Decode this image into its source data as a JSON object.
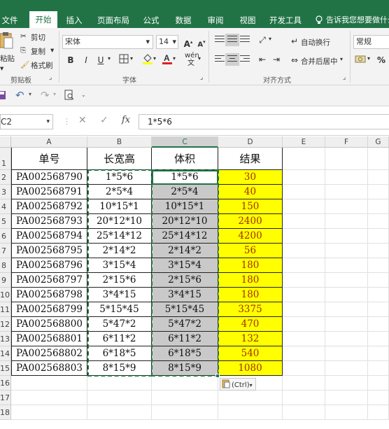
{
  "tabs": {
    "file": "文件",
    "home": "开始",
    "insert": "插入",
    "layout": "页面布局",
    "formulas": "公式",
    "data": "数据",
    "review": "审阅",
    "view": "视图",
    "developer": "开发工具",
    "tell_me": "告诉我您想要做什么"
  },
  "clipboard": {
    "paste": "粘贴",
    "cut": "剪切",
    "copy": "复制",
    "format_painter": "格式刷",
    "group_label": "剪贴板"
  },
  "font": {
    "name": "宋体",
    "size": "14",
    "group_label": "字体",
    "bold": "B",
    "italic": "I",
    "underline": "U"
  },
  "alignment": {
    "wrap_text": "自动换行",
    "merge_center": "合并后居中",
    "group_label": "对齐方式"
  },
  "number": {
    "format": "常规",
    "percent": "%"
  },
  "formula_bar": {
    "name_box": "C2",
    "formula": "1*5*6"
  },
  "columns": [
    "A",
    "B",
    "C",
    "D",
    "E",
    "F",
    "G"
  ],
  "header_row": {
    "a": "单号",
    "b": "长宽高",
    "c": "体积",
    "d": "结果"
  },
  "rows": [
    {
      "n": "2",
      "a": "PA002568790",
      "b": "1*5*6",
      "c": "1*5*6",
      "d": "30"
    },
    {
      "n": "3",
      "a": "PA002568791",
      "b": "2*5*4",
      "c": "2*5*4",
      "d": "40"
    },
    {
      "n": "4",
      "a": "PA002568792",
      "b": "10*15*1",
      "c": "10*15*1",
      "d": "150"
    },
    {
      "n": "5",
      "a": "PA002568793",
      "b": "20*12*10",
      "c": "20*12*10",
      "d": "2400"
    },
    {
      "n": "6",
      "a": "PA002568794",
      "b": "25*14*12",
      "c": "25*14*12",
      "d": "4200"
    },
    {
      "n": "7",
      "a": "PA002568795",
      "b": "2*14*2",
      "c": "2*14*2",
      "d": "56"
    },
    {
      "n": "8",
      "a": "PA002568796",
      "b": "3*15*4",
      "c": "3*15*4",
      "d": "180"
    },
    {
      "n": "9",
      "a": "PA002568797",
      "b": "2*15*6",
      "c": "2*15*6",
      "d": "180"
    },
    {
      "n": "10",
      "a": "PA002568798",
      "b": "3*4*15",
      "c": "3*4*15",
      "d": "180"
    },
    {
      "n": "11",
      "a": "PA002568799",
      "b": "5*15*45",
      "c": "5*15*45",
      "d": "3375"
    },
    {
      "n": "12",
      "a": "PA002568800",
      "b": "5*47*2",
      "c": "5*47*2",
      "d": "470"
    },
    {
      "n": "13",
      "a": "PA002568801",
      "b": "6*11*2",
      "c": "6*11*2",
      "d": "132"
    },
    {
      "n": "14",
      "a": "PA002568802",
      "b": "6*18*5",
      "c": "6*18*5",
      "d": "540"
    },
    {
      "n": "15",
      "a": "PA002568803",
      "b": "8*15*9",
      "c": "8*15*9",
      "d": "1080"
    }
  ],
  "extra_rows": [
    "16",
    "17",
    "18"
  ],
  "header_row_num": "1",
  "paste_options": "(Ctrl)",
  "colors": {
    "accent": "#217346",
    "result_fill": "#ffff00",
    "selected_fill": "#c9c9c9"
  }
}
